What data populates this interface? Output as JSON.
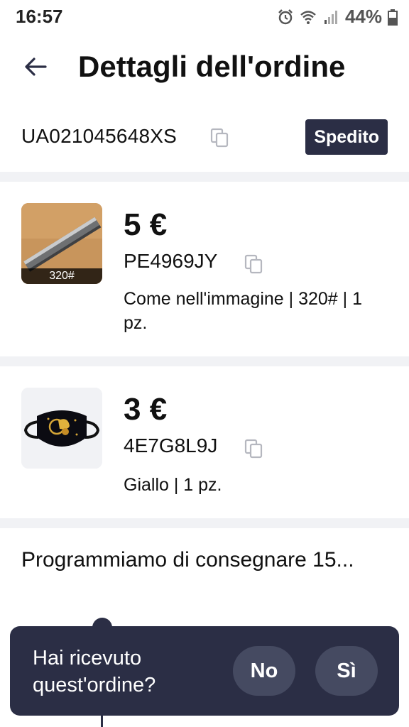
{
  "status_bar": {
    "time": "16:57",
    "battery": "44%",
    "icons": [
      "alarm-icon",
      "wifi-icon",
      "signal-icon",
      "battery-icon"
    ]
  },
  "header": {
    "title": "Dettagli dell'ordine",
    "back_icon": "arrow-left-icon"
  },
  "order": {
    "id": "UA021045648XS",
    "status": "Spedito",
    "status_color": "#2b2e45"
  },
  "items": [
    {
      "price": "5 €",
      "sku": "PE4969JY",
      "description": "Come nell'immagine | 320# | 1 pz.",
      "thumb_label": "320#"
    },
    {
      "price": "3 €",
      "sku": "4E7G8L9J",
      "description": "Giallo | 1 pz."
    }
  ],
  "delivery": {
    "text": "Programmiamo di consegnare 15..."
  },
  "toast": {
    "question": "Hai ricevuto quest'ordine?",
    "no_label": "No",
    "yes_label": "Sì"
  },
  "colors": {
    "accent": "#2b2e45",
    "divider": "#f1f2f5"
  }
}
